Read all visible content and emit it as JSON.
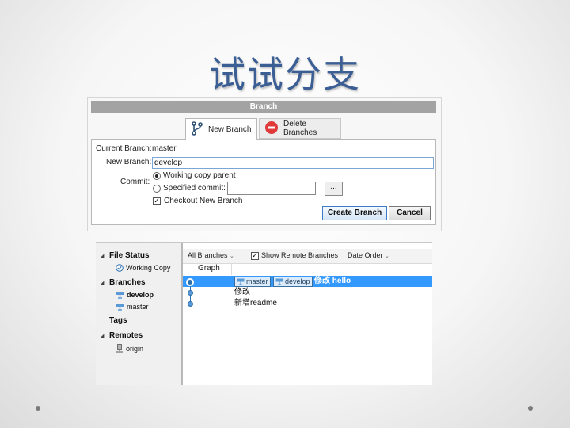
{
  "slide": {
    "title": "试试分支"
  },
  "dialog": {
    "title": "Branch",
    "tabs": [
      {
        "label": "New Branch",
        "icon": "branch-icon"
      },
      {
        "label": "Delete Branches",
        "icon": "delete-icon"
      }
    ],
    "current_branch_label": "Current Branch:",
    "current_branch_value": "master",
    "new_branch_label": "New Branch:",
    "new_branch_value": "develop",
    "commit_label": "Commit:",
    "working_copy_parent_label": "Working copy parent",
    "specified_commit_label": "Specified commit:",
    "browse_label": "...",
    "checkout_label": "Checkout New Branch",
    "create_button": "Create Branch",
    "cancel_button": "Cancel",
    "accent_color": "#3d7bc6"
  },
  "repo": {
    "sidebar": {
      "file_status": "File Status",
      "working_copy": "Working Copy",
      "branches": "Branches",
      "branch_items": [
        "develop",
        "master"
      ],
      "tags": "Tags",
      "remotes": "Remotes",
      "remote_items": [
        "origin"
      ]
    },
    "toolbar": {
      "branches_filter": "All Branches",
      "show_remote": "Show Remote Branches",
      "order": "Date Order"
    },
    "graph_header": "Graph",
    "commits": [
      {
        "tags": [
          "master",
          "develop"
        ],
        "message": "修改 hello",
        "selected": true
      },
      {
        "tags": [],
        "message": "修改",
        "selected": false
      },
      {
        "tags": [],
        "message": "新增readme",
        "selected": false
      }
    ],
    "selection_color": "#3399ff"
  }
}
